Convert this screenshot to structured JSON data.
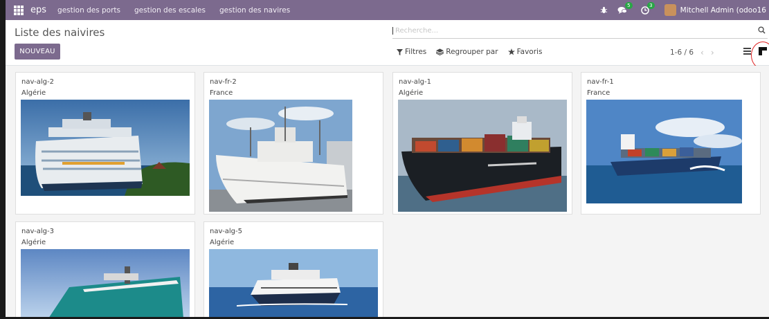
{
  "navbar": {
    "brand": "eps",
    "menus": [
      "gestion des ports",
      "gestion des escales",
      "gestion des navires"
    ],
    "messages_badge": "5",
    "activities_badge": "3",
    "user_name": "Mitchell Admin (odoo16"
  },
  "control_panel": {
    "breadcrumb": "Liste des naivires",
    "new_button": "NOUVEAU",
    "search_placeholder": "Recherche...",
    "filters_label": "Filtres",
    "group_by_label": "Regrouper par",
    "favorites_label": "Favoris",
    "pager_value": "1-6 / 6"
  },
  "cards": [
    {
      "name": "nav-alg-2",
      "country": "Algérie",
      "image": "cruise ship"
    },
    {
      "name": "nav-fr-2",
      "country": "France",
      "image": "white research ship"
    },
    {
      "name": "nav-alg-1",
      "country": "Algérie",
      "image": "container ship"
    },
    {
      "name": "nav-fr-1",
      "country": "France",
      "image": "container ship at sea"
    },
    {
      "name": "nav-alg-3",
      "country": "Algérie",
      "image": "green cargo ship bow"
    },
    {
      "name": "nav-alg-5",
      "country": "Algérie",
      "image": "expedition cruise ship"
    }
  ],
  "colors": {
    "primary": "#7c6a8e",
    "badge": "#28a745",
    "annotation": "#e02020"
  }
}
